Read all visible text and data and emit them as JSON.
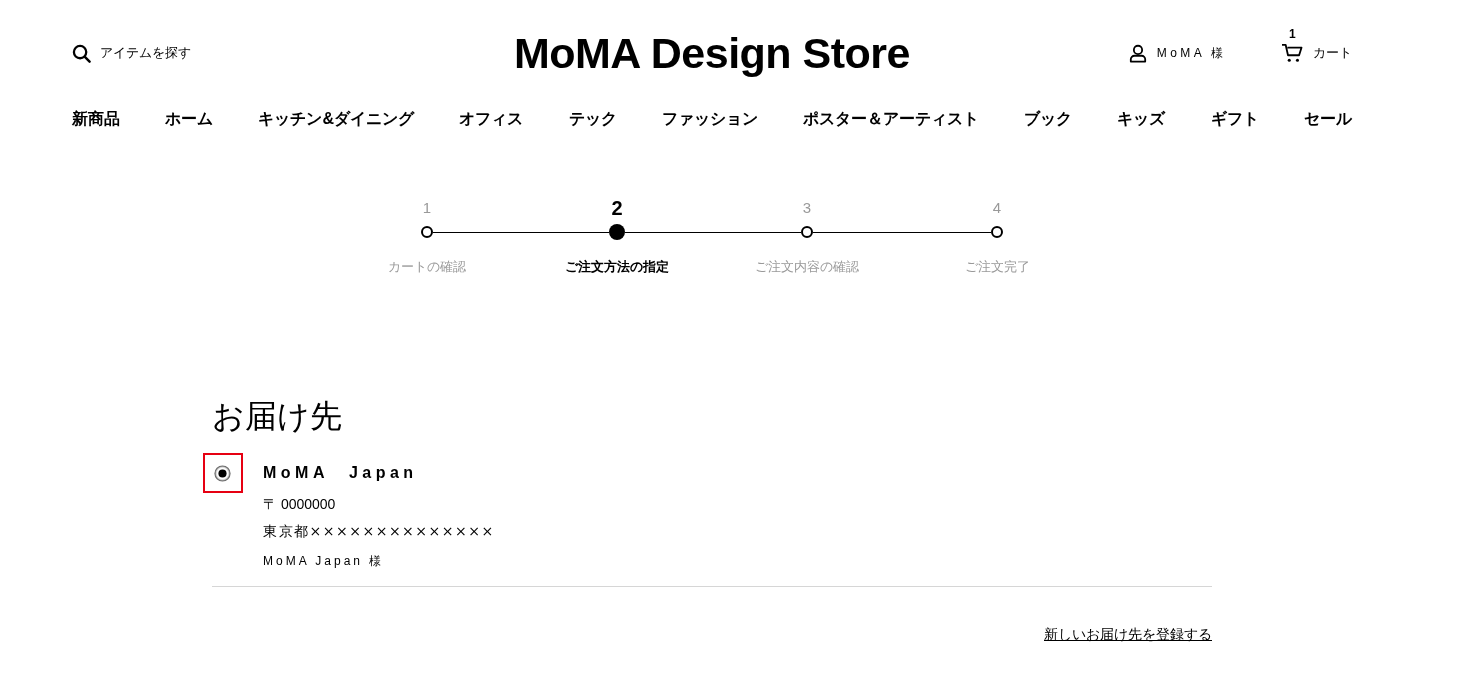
{
  "header": {
    "search": {
      "label": "アイテムを探す"
    },
    "logo": "MoMA Design Store",
    "account": {
      "label": "MoMA 様"
    },
    "cart": {
      "label": "カート",
      "count": "1"
    }
  },
  "nav": {
    "items": [
      {
        "label": "新商品"
      },
      {
        "label": "ホーム"
      },
      {
        "label": "キッチン&ダイニング"
      },
      {
        "label": "オフィス"
      },
      {
        "label": "テック"
      },
      {
        "label": "ファッション"
      },
      {
        "label": "ポスター＆アーティスト"
      },
      {
        "label": "ブック"
      },
      {
        "label": "キッズ"
      },
      {
        "label": "ギフト"
      },
      {
        "label": "セール"
      }
    ]
  },
  "steps": [
    {
      "number": "1",
      "label": "カートの確認",
      "selected": false
    },
    {
      "number": "2",
      "label": "ご注文方法の指定",
      "selected": true
    },
    {
      "number": "3",
      "label": "ご注文内容の確認",
      "selected": false
    },
    {
      "number": "4",
      "label": "ご注文完了",
      "selected": false
    }
  ],
  "delivery": {
    "title": "お届け先",
    "addresses": [
      {
        "selected": true,
        "highlighted": true,
        "name": "MoMA　Japan",
        "postal": "〒 0000000",
        "address": "東京都××××××××××××××",
        "recipient": "MoMA Japan 様"
      }
    ],
    "register_link": "新しいお届け先を登録する"
  }
}
